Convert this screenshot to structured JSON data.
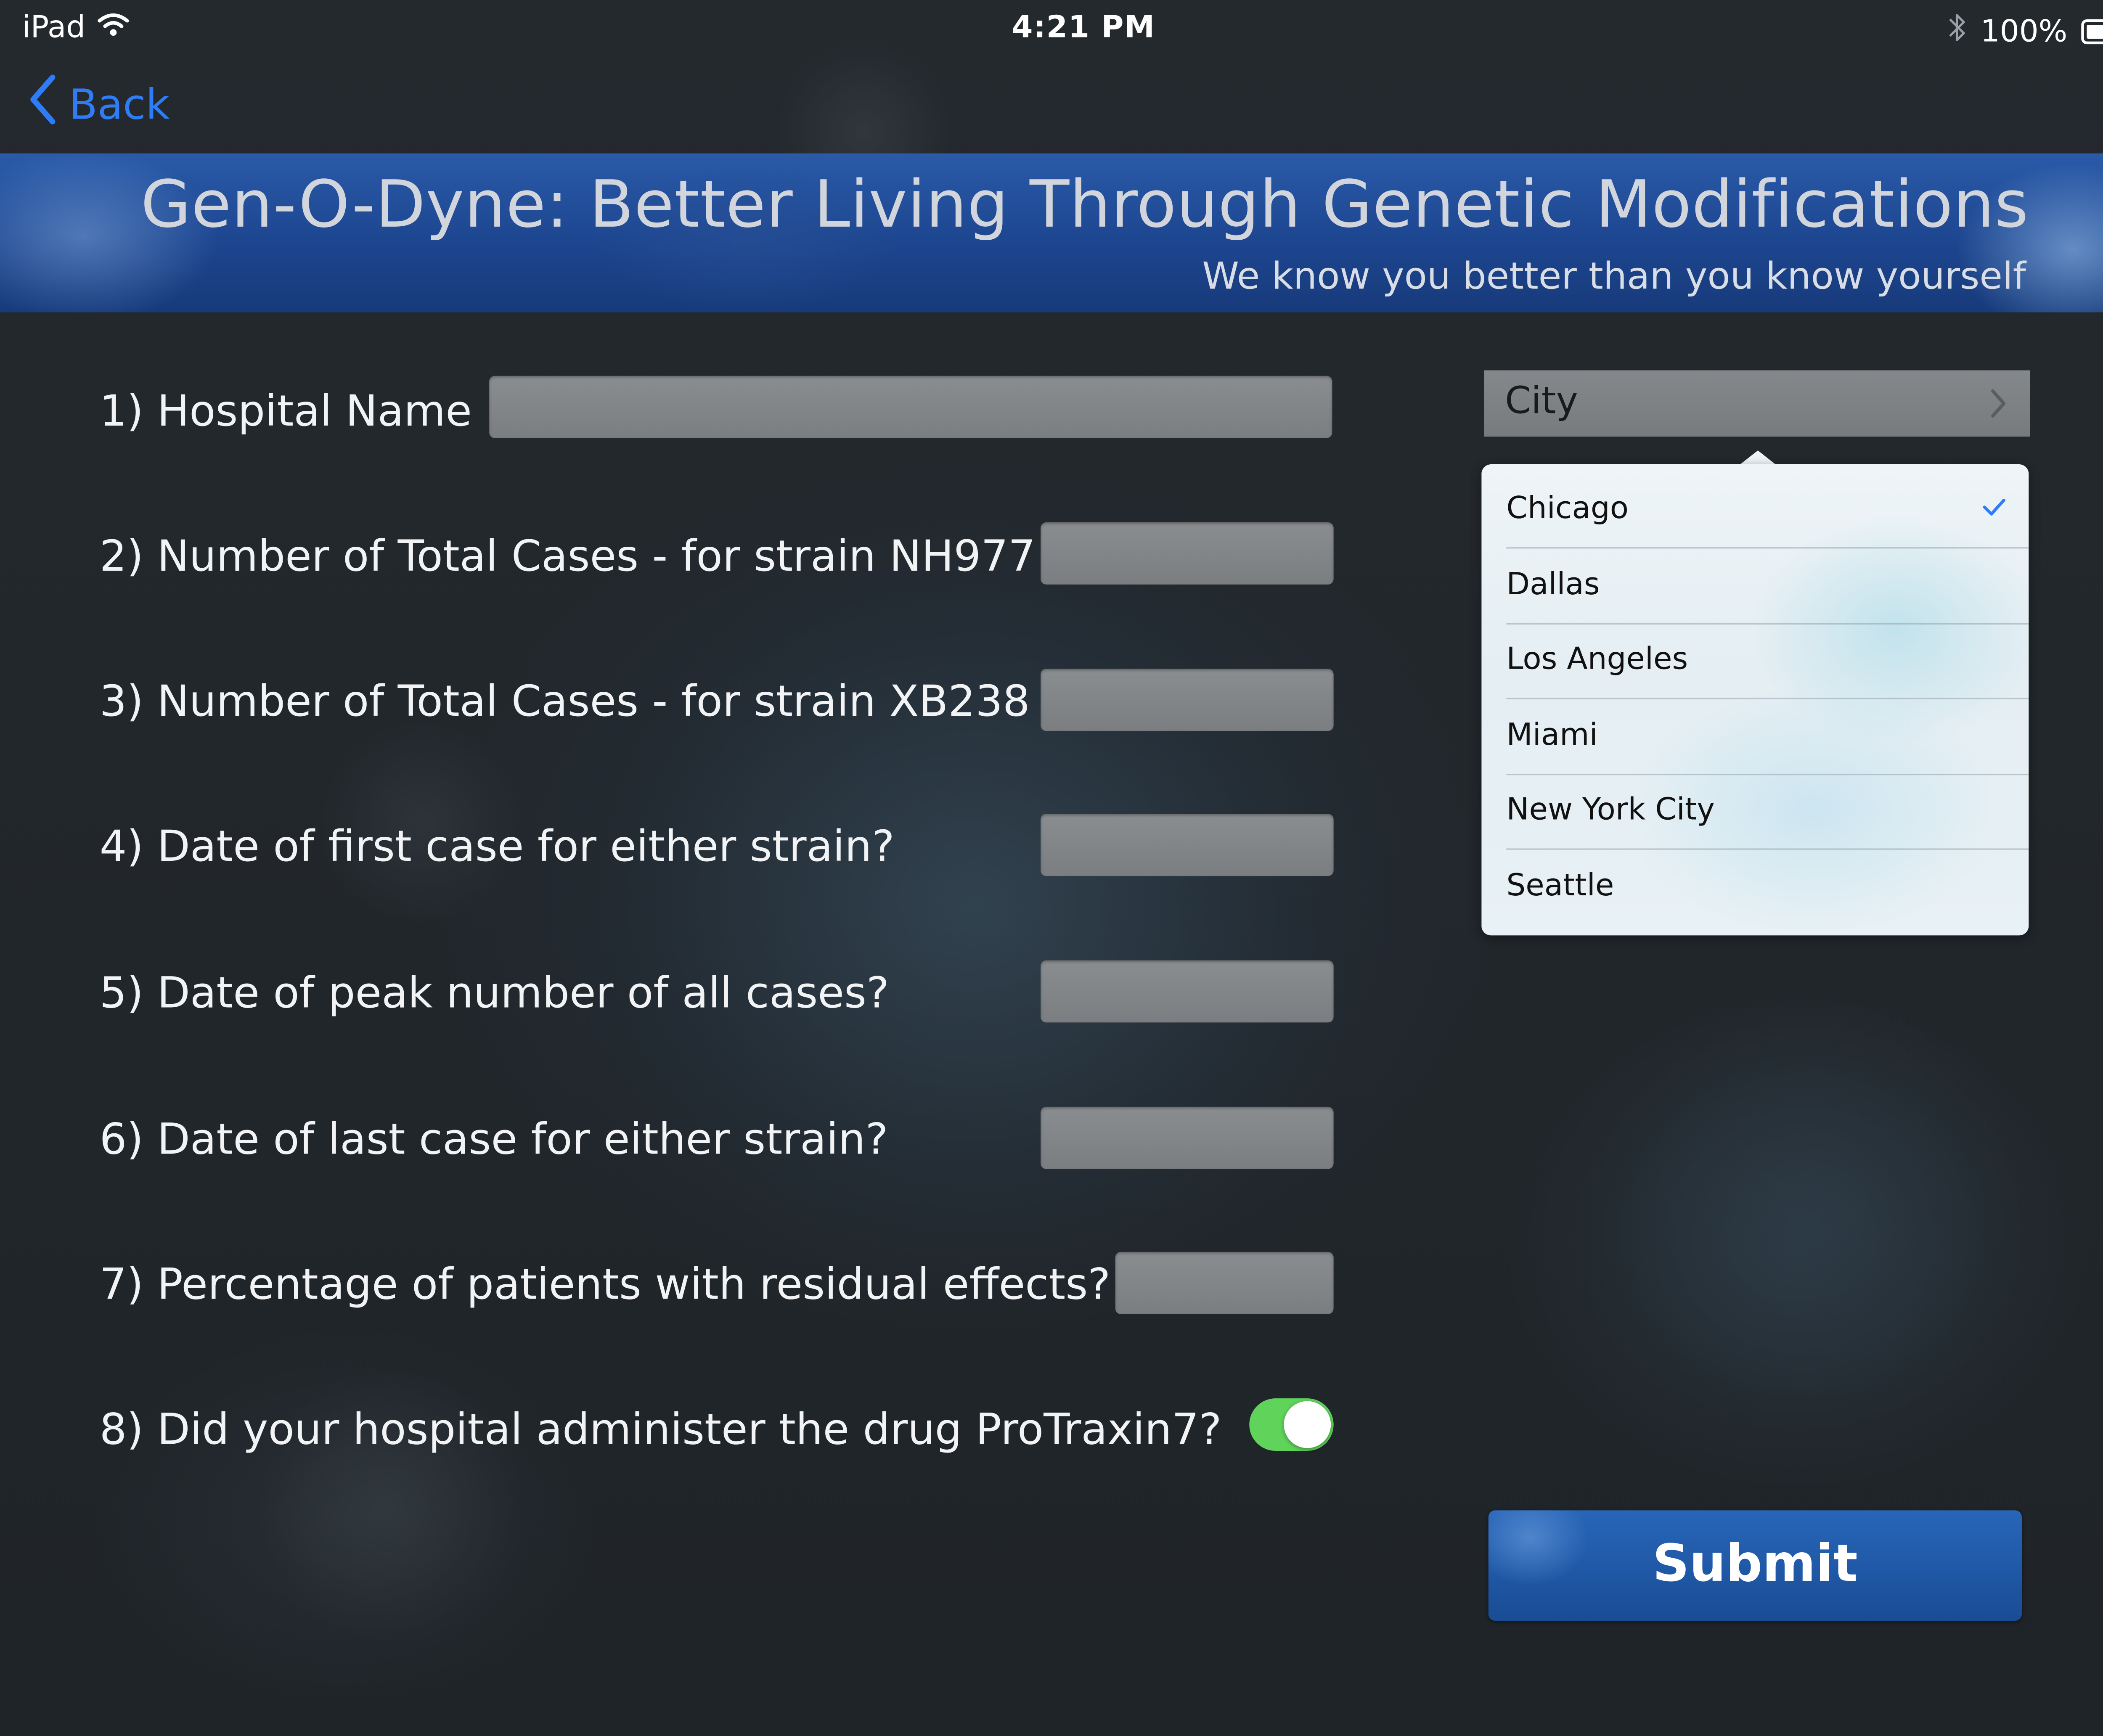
{
  "status_bar": {
    "device": "iPad",
    "time": "4:21 PM",
    "battery_percent": "100%"
  },
  "nav": {
    "back_label": "Back"
  },
  "header": {
    "title": "Gen-O-Dyne: Better Living Through Genetic Modifications",
    "subtitle": "We know you better than you know yourself"
  },
  "form": {
    "questions": [
      {
        "label": "1)  Hospital Name",
        "value": ""
      },
      {
        "label": "2) Number of Total Cases - for strain NH977",
        "value": ""
      },
      {
        "label": "3) Number of Total Cases - for strain XB238",
        "value": ""
      },
      {
        "label": "4) Date of first case for either strain?",
        "value": ""
      },
      {
        "label": "5) Date of peak number of all cases?",
        "value": ""
      },
      {
        "label": "6) Date of last case for either strain?",
        "value": ""
      },
      {
        "label": "7) Percentage of patients with residual effects?",
        "value": ""
      },
      {
        "label": "8) Did your hospital administer the drug ProTraxin7?",
        "toggle_on": true
      }
    ]
  },
  "city_picker": {
    "label": "City",
    "options": [
      "Chicago",
      "Dallas",
      "Los Angeles",
      "Miami",
      "New York City",
      "Seattle"
    ],
    "selected": "Chicago"
  },
  "submit_label": "Submit",
  "colors": {
    "accent_blue": "#2f7df6",
    "banner_blue": "#1d4690",
    "toggle_green": "#5fd35a",
    "submit_blue": "#1f58a6"
  },
  "icons": [
    "wifi-icon",
    "bluetooth-icon",
    "battery-icon",
    "chevron-left-icon",
    "chevron-right-icon",
    "checkmark-icon"
  ]
}
